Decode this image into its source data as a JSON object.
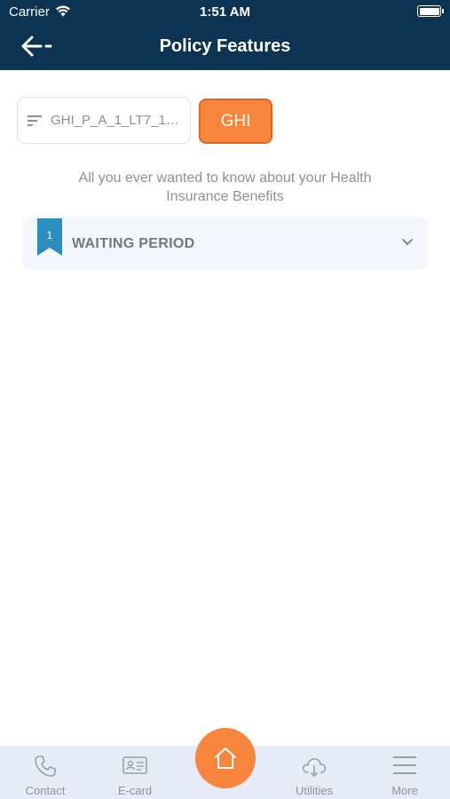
{
  "status_bar": {
    "carrier": "Carrier",
    "time": "1:51 AM"
  },
  "header": {
    "title": "Policy Features"
  },
  "policy_selector": {
    "value": "GHI_P_A_1_LT7_120..."
  },
  "type_button": {
    "label": "GHI"
  },
  "subtitle": "All you ever wanted to know about your Health Insurance Benefits",
  "accordion": [
    {
      "number": "1",
      "label": "WAITING PERIOD"
    }
  ],
  "bottom_nav": {
    "contact": "Contact",
    "ecard": "E-card",
    "utilities": "Utilities",
    "more": "More"
  },
  "colors": {
    "header": "#0c3352",
    "accent": "#f7853c",
    "ribbon": "#2a8fc0"
  }
}
